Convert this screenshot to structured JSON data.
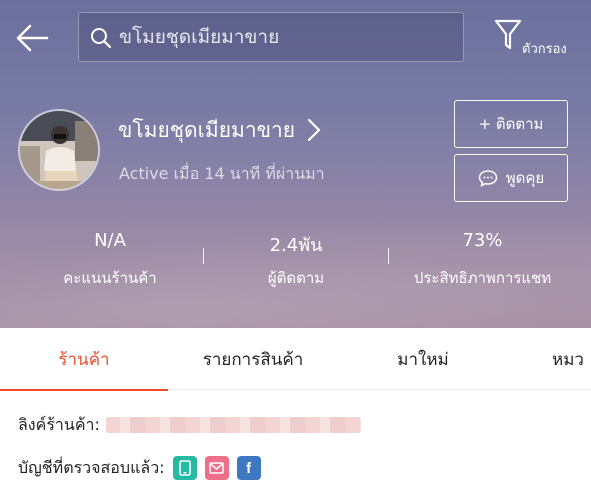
{
  "header": {
    "search_placeholder": "ขโมยชุดเมียมาขาย",
    "filter_label": "ตัวกรอง"
  },
  "shop": {
    "name": "ขโมยชุดเมียมาขาย",
    "active_status": "Active เมื่อ 14 นาที ที่ผ่านมา",
    "follow_label": "+ ติดตาม",
    "chat_label": "พูดคุย"
  },
  "stats": [
    {
      "value": "N/A",
      "label": "คะแนนร้านค้า"
    },
    {
      "value": "2.4พัน",
      "label": "ผู้ติดตาม"
    },
    {
      "value": "73%",
      "label": "ประสิทธิภาพการแชท"
    }
  ],
  "tabs": [
    {
      "label": "ร้านค้า"
    },
    {
      "label": "รายการสินค้า"
    },
    {
      "label": "มาใหม่"
    },
    {
      "label": "หมว"
    }
  ],
  "info": {
    "link_label": "ลิงค์ร้านค้า:",
    "verified_label": "บัญชีที่ตรวจสอบแล้ว:",
    "verified_icons": [
      "phone-icon",
      "mail-icon",
      "facebook-icon"
    ],
    "fb_letter": "f"
  },
  "colors": {
    "accent": "#ee4d2d",
    "phone_badge": "#26b9a3",
    "mail_badge": "#ef6f8a",
    "facebook_badge": "#3d78c0"
  }
}
